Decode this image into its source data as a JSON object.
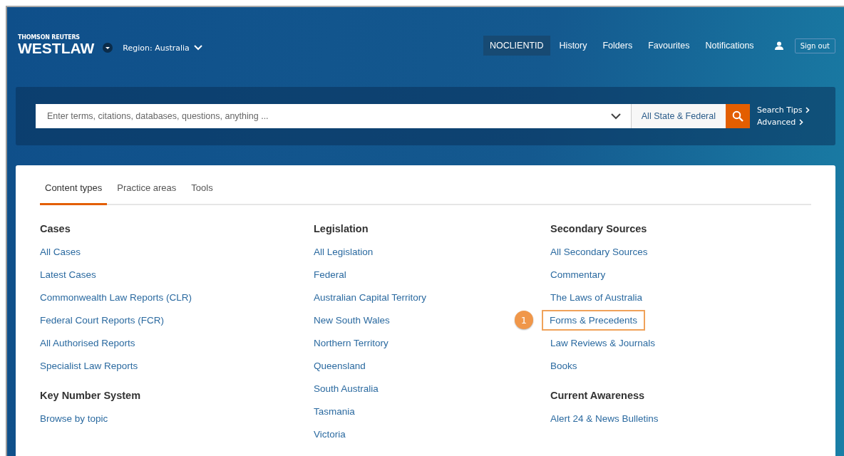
{
  "header": {
    "brand_small": "THOMSON REUTERS",
    "brand": "WESTLAW",
    "region": "Region: Australia",
    "nav": [
      {
        "label": "NOCLIENTID",
        "selected": true
      },
      {
        "label": "History",
        "selected": false
      },
      {
        "label": "Folders",
        "selected": false
      },
      {
        "label": "Favourites",
        "selected": false
      },
      {
        "label": "Notifications",
        "selected": false
      }
    ],
    "sign_out": "Sign out"
  },
  "search": {
    "placeholder": "Enter terms, citations, databases, questions, anything ...",
    "jurisdiction": "All State & Federal",
    "links": [
      "Search Tips",
      "Advanced"
    ]
  },
  "tabs": [
    {
      "label": "Content types",
      "selected": true
    },
    {
      "label": "Practice areas",
      "selected": false
    },
    {
      "label": "Tools",
      "selected": false
    }
  ],
  "columns": [
    {
      "sections": [
        {
          "heading": "Cases",
          "items": [
            {
              "label": "All Cases",
              "highlighted": false
            },
            {
              "label": "Latest Cases",
              "highlighted": false
            },
            {
              "label": "Commonwealth Law Reports (CLR)",
              "highlighted": false
            },
            {
              "label": "Federal Court Reports (FCR)",
              "highlighted": false
            },
            {
              "label": "All Authorised Reports",
              "highlighted": false
            },
            {
              "label": "Specialist Law Reports",
              "highlighted": false
            }
          ]
        },
        {
          "heading": "Key Number System",
          "items": [
            {
              "label": "Browse by topic",
              "highlighted": false
            }
          ]
        }
      ]
    },
    {
      "sections": [
        {
          "heading": "Legislation",
          "items": [
            {
              "label": "All Legislation",
              "highlighted": false
            },
            {
              "label": "Federal",
              "highlighted": false
            },
            {
              "label": "Australian Capital Territory",
              "highlighted": false
            },
            {
              "label": "New South Wales",
              "highlighted": false
            },
            {
              "label": "Northern Territory",
              "highlighted": false
            },
            {
              "label": "Queensland",
              "highlighted": false
            },
            {
              "label": "South Australia",
              "highlighted": false
            },
            {
              "label": "Tasmania",
              "highlighted": false
            },
            {
              "label": "Victoria",
              "highlighted": false
            }
          ]
        }
      ]
    },
    {
      "sections": [
        {
          "heading": "Secondary Sources",
          "items": [
            {
              "label": "All Secondary Sources",
              "highlighted": false
            },
            {
              "label": "Commentary",
              "highlighted": false
            },
            {
              "label": "The Laws of Australia",
              "highlighted": false
            },
            {
              "label": "Forms & Precedents",
              "highlighted": true,
              "callout": "1"
            },
            {
              "label": "Law Reviews & Journals",
              "highlighted": false
            },
            {
              "label": "Books",
              "highlighted": false
            }
          ]
        },
        {
          "heading": "Current Awareness",
          "items": [
            {
              "label": "Alert 24 & News Bulletins",
              "highlighted": false
            }
          ]
        }
      ]
    }
  ]
}
